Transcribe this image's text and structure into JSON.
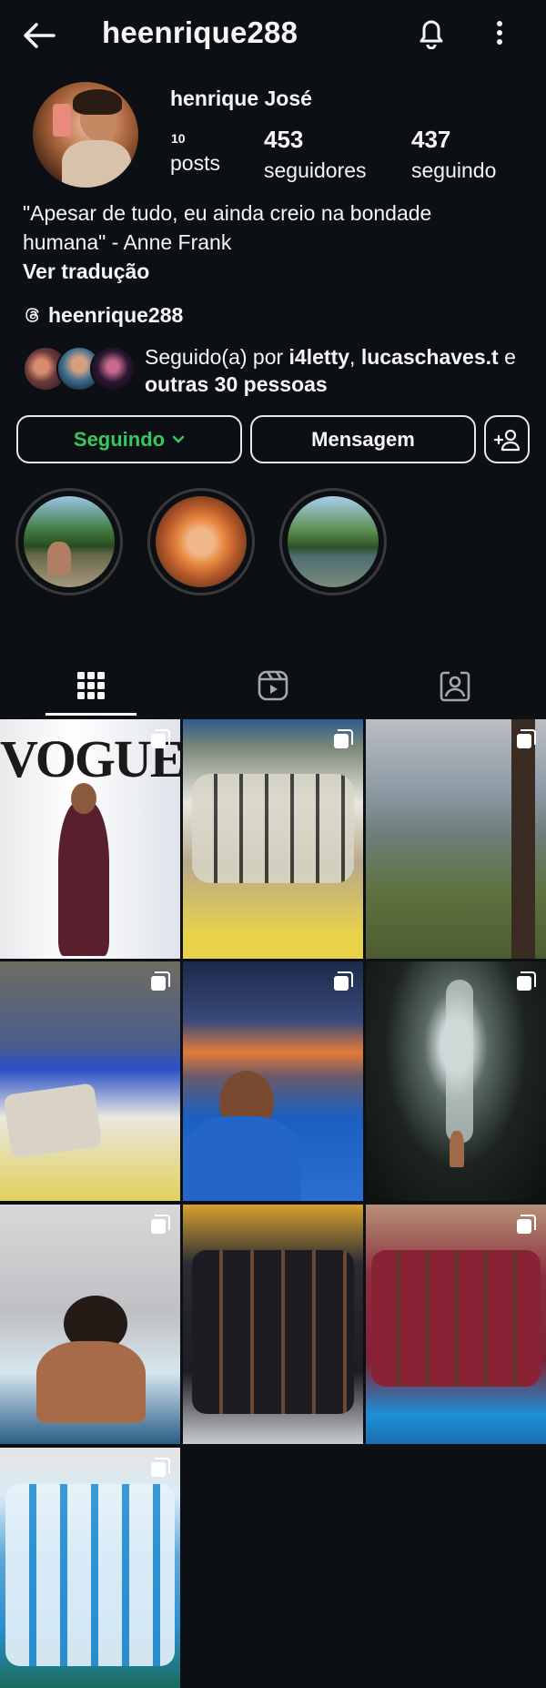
{
  "header": {
    "username": "heenrique288",
    "back_icon": "arrow-left-icon",
    "notification_icon": "bell-icon",
    "more_icon": "more-vertical-icon"
  },
  "profile": {
    "full_name": "henrique José",
    "posts_count": "10",
    "posts_label": "posts",
    "followers_count": "453",
    "followers_label": "seguidores",
    "following_count": "437",
    "following_label": "seguindo",
    "bio": "\"Apesar de tudo, eu ainda creio na bondade humana\" - Anne Frank",
    "translate_label": "Ver tradução",
    "threads_handle": "heenrique288"
  },
  "mutual": {
    "prefix": "Seguido(a) por ",
    "user1": "i4letty",
    "separator": ", ",
    "user2": "lucaschaves.t",
    "middle": " e ",
    "others": "outras 30 pessoas"
  },
  "actions": {
    "follow_label": "Seguindo",
    "message_label": "Mensagem",
    "add_user_icon": "add-person-icon"
  },
  "highlights": [
    {
      "name": "highlight-1"
    },
    {
      "name": "highlight-2"
    },
    {
      "name": "highlight-3"
    }
  ],
  "tabs": [
    {
      "icon": "grid-icon",
      "active": true
    },
    {
      "icon": "reels-icon",
      "active": false
    },
    {
      "icon": "tagged-icon",
      "active": false
    }
  ],
  "posts": {
    "vogue_text": "VOGUE"
  },
  "colors": {
    "background": "#0c1014",
    "text": "#f5f5f5",
    "follow_green": "#39c760"
  }
}
